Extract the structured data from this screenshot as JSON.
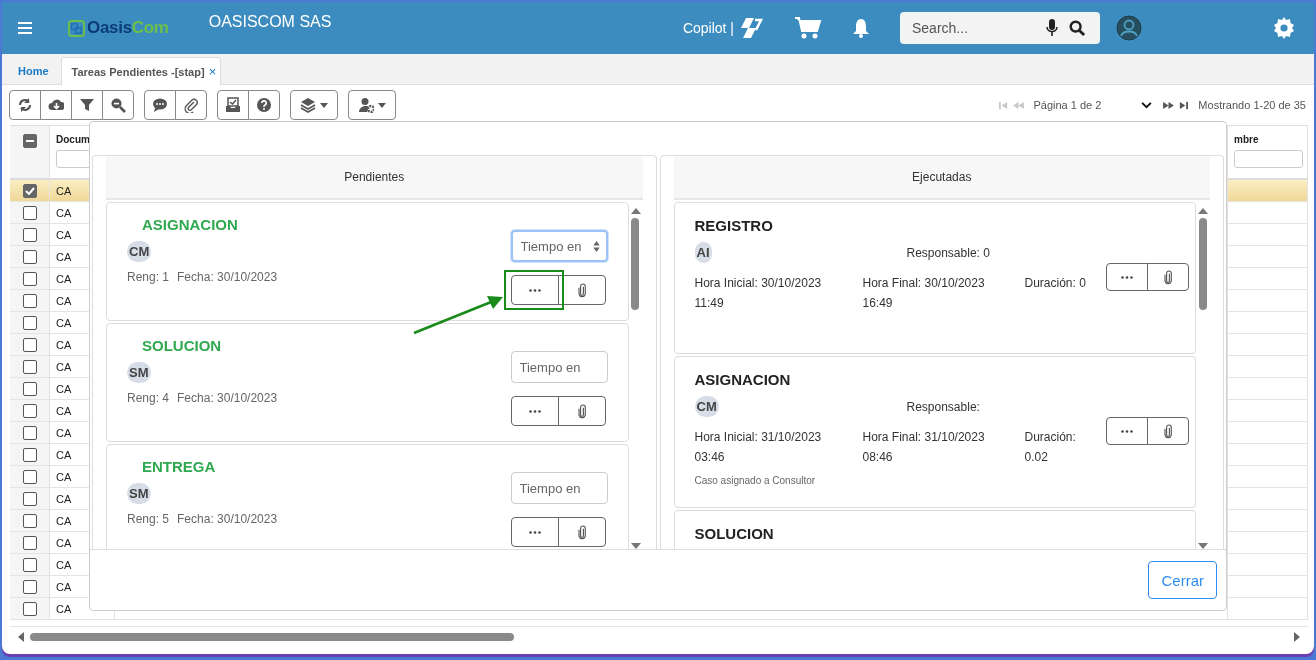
{
  "header": {
    "logo": {
      "part_1": "Oasis",
      "part_2": "Com"
    },
    "company": "OASISCOM SAS",
    "copilot_label": "Copilot |",
    "search": {
      "placeholder": "Search..."
    }
  },
  "tabs": [
    {
      "label": "Home",
      "selected": false
    },
    {
      "label": "Tareas Pendientes -[stap]",
      "selected": true,
      "close_glyph": "×"
    }
  ],
  "pager": {
    "back_disabled": true,
    "page_label": "Página 1 de 2",
    "range_label": "Mostrando 1-20 de 35"
  },
  "grid": {
    "header_checkbox": {
      "indeterminate": true
    },
    "columns": [
      {
        "label": "Docum"
      },
      {
        "label": "mbre"
      }
    ],
    "rows": [
      {
        "checked": true,
        "selected": true,
        "document": "CA"
      },
      {
        "checked": false,
        "selected": false,
        "document": "CA"
      },
      {
        "checked": false,
        "selected": false,
        "document": "CA"
      },
      {
        "checked": false,
        "selected": false,
        "document": "CA"
      },
      {
        "checked": false,
        "selected": false,
        "document": "CA"
      },
      {
        "checked": false,
        "selected": false,
        "document": "CA"
      },
      {
        "checked": false,
        "selected": false,
        "document": "CA"
      },
      {
        "checked": false,
        "selected": false,
        "document": "CA"
      },
      {
        "checked": false,
        "selected": false,
        "document": "CA"
      },
      {
        "checked": false,
        "selected": false,
        "document": "CA"
      },
      {
        "checked": false,
        "selected": false,
        "document": "CA"
      },
      {
        "checked": false,
        "selected": false,
        "document": "CA"
      },
      {
        "checked": false,
        "selected": false,
        "document": "CA"
      },
      {
        "checked": false,
        "selected": false,
        "document": "CA"
      },
      {
        "checked": false,
        "selected": false,
        "document": "CA"
      },
      {
        "checked": false,
        "selected": false,
        "document": "CA"
      },
      {
        "checked": false,
        "selected": false,
        "document": "CA"
      },
      {
        "checked": false,
        "selected": false,
        "document": "CA"
      },
      {
        "checked": false,
        "selected": false,
        "document": "CA"
      },
      {
        "checked": false,
        "selected": false,
        "document": "CA"
      }
    ]
  },
  "modal": {
    "pending": {
      "title": "Pendientes",
      "cards": [
        {
          "title": "ASIGNACION",
          "initials": "CM",
          "reng": "Reng: 1",
          "fecha": "Fecha: 30/10/2023",
          "time_placeholder": "Tiempo en",
          "focused": true
        },
        {
          "title": "SOLUCION",
          "initials": "SM",
          "reng": "Reng: 4",
          "fecha": "Fecha: 30/10/2023",
          "time_placeholder": "Tiempo en",
          "focused": false
        },
        {
          "title": "ENTREGA",
          "initials": "SM",
          "reng": "Reng: 5",
          "fecha": "Fecha: 30/10/2023",
          "time_placeholder": "Tiempo en",
          "focused": false
        }
      ]
    },
    "executed": {
      "title": "Ejecutadas",
      "cards": [
        {
          "title": "REGISTRO",
          "initials": "AI",
          "responsable": "Responsable: 0",
          "start": "Hora Inicial: 30/10/2023 11:49",
          "end": "Hora Final: 30/10/2023 16:49",
          "duration": "Duración: 0"
        },
        {
          "title": "ASIGNACION",
          "initials": "CM",
          "responsable": "Responsable:",
          "start": "Hora Inicial: 31/10/2023 03:46",
          "end": "Hora Final: 31/10/2023 08:46",
          "duration": "Duración: 0.02",
          "note": "Caso asignado a Consultor"
        },
        {
          "title": "SOLUCION"
        }
      ]
    },
    "close_button": "Cerrar"
  }
}
